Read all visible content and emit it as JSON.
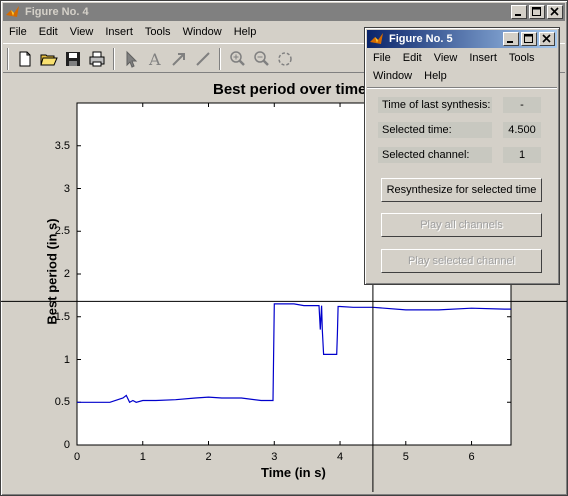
{
  "window4": {
    "title": "Figure No. 4",
    "menu": [
      "File",
      "Edit",
      "View",
      "Insert",
      "Tools",
      "Window",
      "Help"
    ]
  },
  "window5": {
    "title": "Figure No. 5",
    "menu_row1": [
      "File",
      "Edit",
      "View",
      "Insert",
      "Tools"
    ],
    "menu_row2": [
      "Window",
      "Help"
    ],
    "fields": [
      {
        "label": "Time of last synthesis:",
        "value": "-"
      },
      {
        "label": "Selected time:",
        "value": "4.500"
      },
      {
        "label": "Selected channel:",
        "value": "1"
      }
    ],
    "buttons": {
      "resynth": "Resynthesize for selected time",
      "play_all": "Play all channels",
      "play_selected": "Play selected channel"
    }
  },
  "colors": {
    "line": "#0000cc",
    "title_active": "#0a246a",
    "title_inactive": "#808080"
  },
  "chart_data": {
    "type": "line",
    "title": "Best period over time",
    "xlabel": "Time (in s)",
    "ylabel": "Best period (in s)",
    "xlim": [
      0,
      6.6
    ],
    "ylim": [
      0,
      4
    ],
    "xticks": [
      0,
      1,
      2,
      3,
      4,
      5,
      6
    ],
    "yticks": [
      0,
      0.5,
      1,
      1.5,
      2,
      2.5,
      3,
      3.5
    ],
    "ytick_labels": [
      "0",
      "0.5",
      "1",
      "1.5",
      "2",
      "2.5",
      "3",
      "3.5"
    ],
    "crosshair": {
      "x": 4.5,
      "y": 1.68
    },
    "series": [
      {
        "x": [
          0,
          0.5,
          0.7,
          0.75,
          0.8,
          0.85,
          0.9,
          1.0,
          1.2,
          1.5,
          1.8,
          2.0,
          2.2,
          2.5,
          2.8,
          2.98,
          3.0,
          3.3,
          3.45,
          3.68,
          3.7,
          3.72,
          3.73,
          3.75,
          3.78,
          3.95,
          3.96,
          3.97,
          4.0,
          4.2,
          4.5,
          5.0,
          5.5,
          6.0,
          6.5,
          6.6
        ],
        "y": [
          0.5,
          0.5,
          0.55,
          0.58,
          0.5,
          0.52,
          0.5,
          0.52,
          0.52,
          0.53,
          0.55,
          0.56,
          0.55,
          0.55,
          0.52,
          0.52,
          1.65,
          1.65,
          1.63,
          1.63,
          1.35,
          1.63,
          1.35,
          1.06,
          1.06,
          1.06,
          1.3,
          1.62,
          1.62,
          1.61,
          1.61,
          1.58,
          1.58,
          1.6,
          1.59,
          1.59
        ]
      }
    ]
  }
}
